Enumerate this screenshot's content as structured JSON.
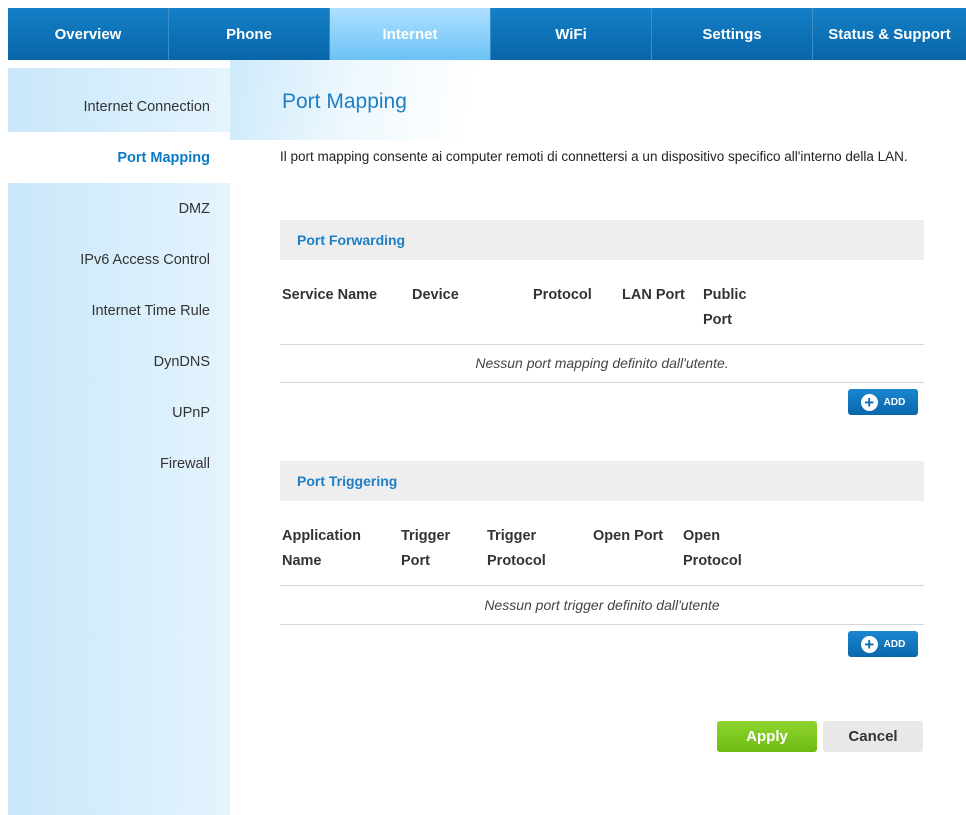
{
  "nav": {
    "tabs": [
      {
        "label": "Overview"
      },
      {
        "label": "Phone"
      },
      {
        "label": "Internet"
      },
      {
        "label": "WiFi"
      },
      {
        "label": "Settings"
      },
      {
        "label": "Status & Support"
      }
    ],
    "active": "Internet"
  },
  "sidebar": {
    "items": [
      {
        "label": "Internet Connection"
      },
      {
        "label": "Port Mapping"
      },
      {
        "label": "DMZ"
      },
      {
        "label": "IPv6 Access Control"
      },
      {
        "label": "Internet Time Rule"
      },
      {
        "label": "DynDNS"
      },
      {
        "label": "UPnP"
      },
      {
        "label": "Firewall"
      }
    ],
    "active": "Port Mapping"
  },
  "main": {
    "title": "Port Mapping",
    "description": "Il port mapping consente ai computer remoti di connettersi a un dispositivo specifico all'interno della LAN.",
    "port_forwarding": {
      "title": "Port Forwarding",
      "columns": [
        "Service Name",
        "Device",
        "Protocol",
        "LAN Port",
        "Public Port"
      ],
      "empty_text": "Nessun port mapping definito dall'utente.",
      "add_label": "ADD"
    },
    "port_triggering": {
      "title": "Port Triggering",
      "columns": [
        "Application Name",
        "Trigger Port",
        "Trigger Protocol",
        "Open Port",
        "Open Protocol"
      ],
      "empty_text": "Nessun port trigger definito dall'utente",
      "add_label": "ADD"
    },
    "apply_label": "Apply",
    "cancel_label": "Cancel"
  },
  "colors": {
    "nav_blue": "#0a6db0",
    "accent_blue": "#1e7fc4",
    "apply_green": "#7ac520",
    "sidebar_bg": "#d3ecfb"
  }
}
